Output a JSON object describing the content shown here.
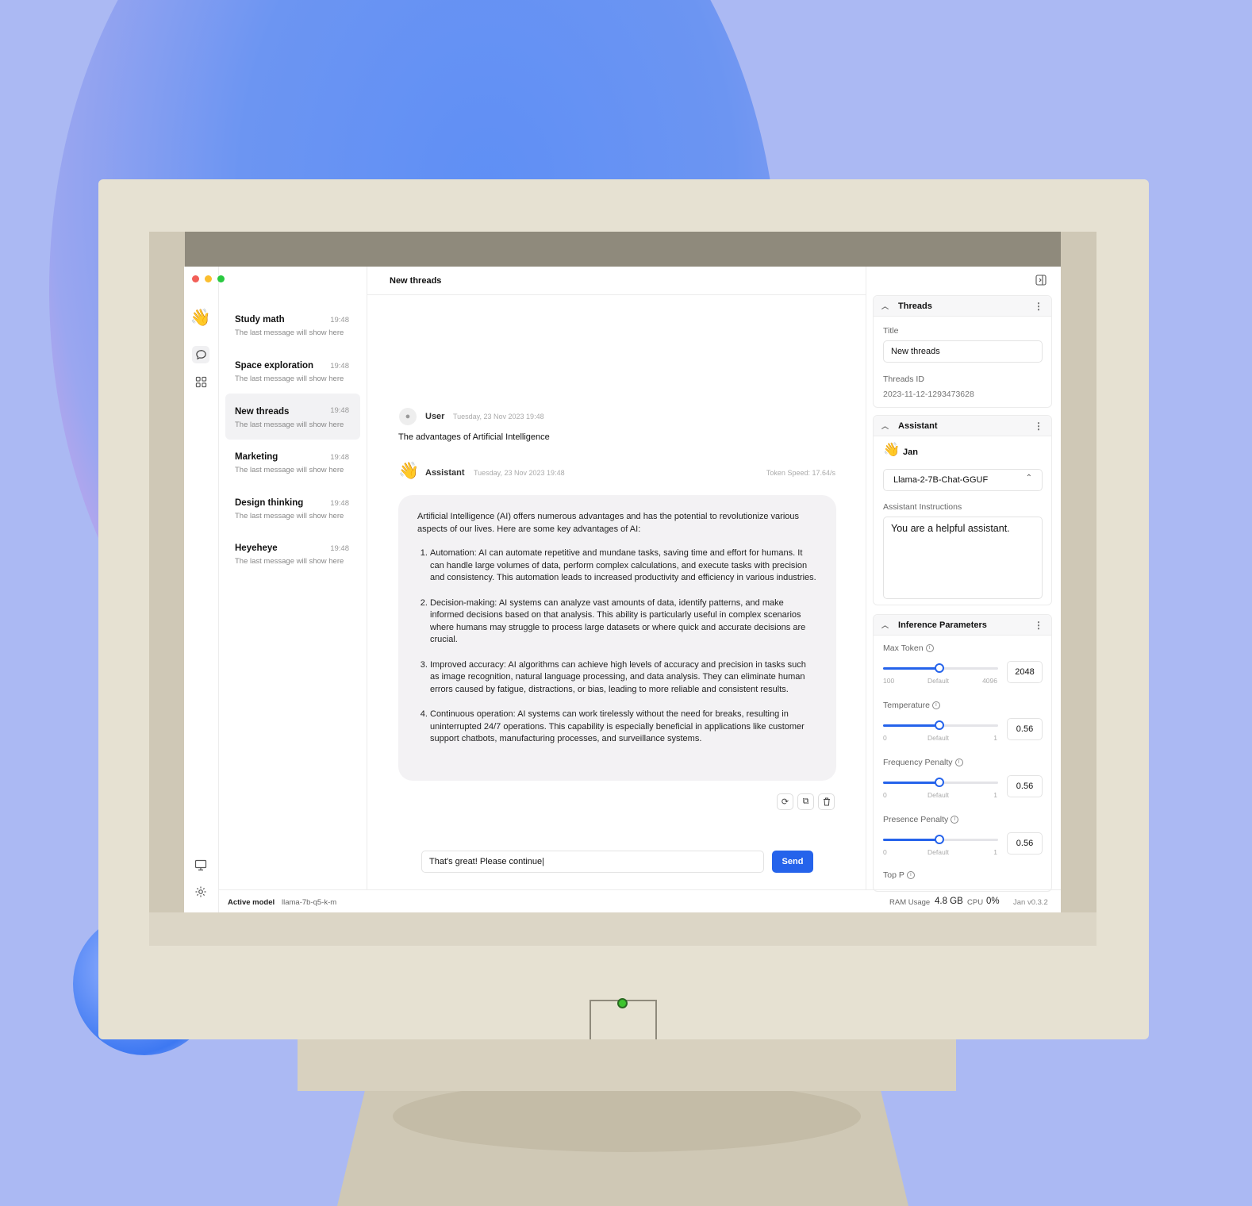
{
  "app": {
    "header_title": "New threads"
  },
  "sidebar": {
    "icons": [
      "wave-logo-icon",
      "chat-icon",
      "grid-icon",
      "monitor-icon",
      "gear-icon"
    ],
    "logo_glyph": "👋"
  },
  "threads": [
    {
      "title": "Study math",
      "time": "19:48",
      "preview": "The last message will show here"
    },
    {
      "title": "Space exploration",
      "time": "19:48",
      "preview": "The last message will show here"
    },
    {
      "title": "New threads",
      "time": "19:48",
      "preview": "The last message will show here"
    },
    {
      "title": "Marketing",
      "time": "19:48",
      "preview": "The last message will show here"
    },
    {
      "title": "Design thinking",
      "time": "19:48",
      "preview": "The last message will show here"
    },
    {
      "title": "Heyeheye",
      "time": "19:48",
      "preview": "The last message will show here"
    }
  ],
  "chat": {
    "user": {
      "name": "User",
      "time": "Tuesday, 23 Nov 2023 19:48",
      "text": "The advantages of Artificial Intelligence"
    },
    "assistant": {
      "name": "Assistant",
      "time": "Tuesday, 23 Nov 2023 19:48",
      "token_speed": "Token Speed: 17.64/s",
      "intro": "Artificial Intelligence (AI) offers numerous advantages and has the potential to revolutionize various aspects of our lives. Here are some key advantages of AI:",
      "points": [
        "Automation: AI can automate repetitive and mundane tasks, saving time and effort for humans. It can handle large volumes of data, perform complex calculations, and execute tasks with precision and consistency. This automation leads to increased productivity and efficiency in various industries.",
        "Decision-making: AI systems can analyze vast amounts of data, identify patterns, and make informed decisions based on that analysis. This ability is particularly useful in complex scenarios where humans may struggle to process large datasets or where quick and accurate decisions are crucial.",
        "Improved accuracy: AI algorithms can achieve high levels of accuracy and precision in tasks such as image recognition, natural language processing, and data analysis. They can eliminate human errors caused by fatigue, distractions, or bias, leading to more reliable and consistent results.",
        "Continuous operation: AI systems can work tirelessly without the need for breaks, resulting in uninterrupted 24/7 operations. This capability is especially beneficial in applications like customer support chatbots, manufacturing processes, and surveillance systems."
      ]
    },
    "input_value": "That's great! Please continue|",
    "send_label": "Send"
  },
  "right_panel": {
    "threads_section": {
      "title": "Threads",
      "title_label": "Title",
      "title_value": "New threads",
      "id_label": "Threads ID",
      "id_value": "2023-11-12-1293473628"
    },
    "assistant_section": {
      "title": "Assistant",
      "name": "Jan",
      "model": "Llama-2-7B-Chat-GGUF",
      "instructions_label": "Assistant Instructions",
      "instructions_value": "You are a helpful assistant."
    },
    "inference_section": {
      "title": "Inference Parameters",
      "params": [
        {
          "label": "Max Token",
          "min": "100",
          "mid": "Default",
          "max": "4096",
          "value": "2048",
          "fraction": 0.49
        },
        {
          "label": "Temperature",
          "min": "0",
          "mid": "Default",
          "max": "1",
          "value": "0.56",
          "fraction": 0.49
        },
        {
          "label": "Frequency Penalty",
          "min": "0",
          "mid": "Default",
          "max": "1",
          "value": "0.56",
          "fraction": 0.49
        },
        {
          "label": "Presence Penalty",
          "min": "0",
          "mid": "Default",
          "max": "1",
          "value": "0.56",
          "fraction": 0.49
        }
      ],
      "next_label": "Top P"
    }
  },
  "status": {
    "active_model_label": "Active model",
    "active_model_value": "llama-7b-q5-k-m",
    "ram_label": "RAM Usage",
    "ram_value": "4.8 GB",
    "cpu_label": "CPU",
    "cpu_value": "0%",
    "version": "Jan v0.3.2"
  },
  "colors": {
    "accent": "#2563eb",
    "traffic_red": "#f25f58",
    "traffic_yellow": "#fbbe2e",
    "traffic_green": "#29c940"
  }
}
